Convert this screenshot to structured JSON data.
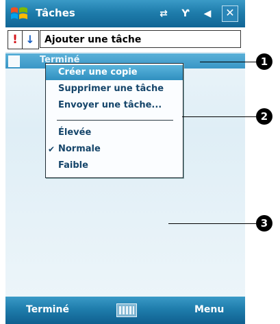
{
  "titlebar": {
    "app_title": "Tâches",
    "icons": [
      "windows-start-icon",
      "connectivity-icon",
      "signal-icon",
      "volume-icon",
      "close-icon"
    ],
    "close_label": "✕"
  },
  "entry": {
    "priority_high": "!",
    "sort_icon": "↓",
    "input_value": "Ajouter une tâche"
  },
  "task_item": {
    "label": "Terminé"
  },
  "context_menu": {
    "items": [
      {
        "label": "Créer une copie",
        "selected": true
      },
      {
        "label": "Supprimer une tâche"
      },
      {
        "label": "Envoyer une tâche..."
      }
    ],
    "priority_items": [
      {
        "label": "Élevée"
      },
      {
        "label": "Normale",
        "checked": true,
        "check": "✔"
      },
      {
        "label": "Faible"
      }
    ]
  },
  "bottombar": {
    "left_softkey": "Terminé",
    "right_softkey": "Menu"
  },
  "callouts": [
    "1",
    "2",
    "3"
  ],
  "colors": {
    "titlebar": "#1f7dac",
    "selected": "#3a96c6",
    "menu_text": "#15456a"
  }
}
